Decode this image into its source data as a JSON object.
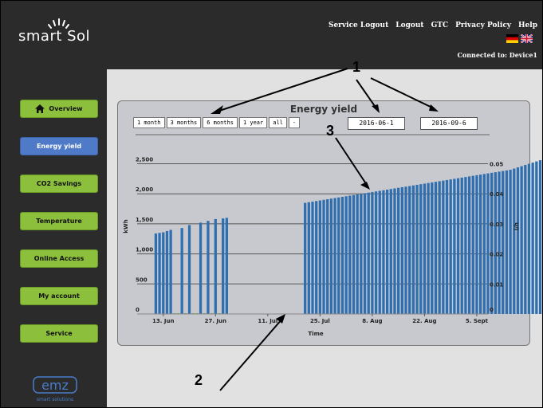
{
  "header": {
    "logo_text": "smart Sol",
    "links": [
      "Service Logout",
      "Logout",
      "GTC",
      "Privacy Policy",
      "Help"
    ],
    "connected_label": "Connected to:",
    "connected_device": "Device1"
  },
  "sidebar": {
    "items": [
      {
        "label": "Overview",
        "active": false
      },
      {
        "label": "Energy yield",
        "active": true
      },
      {
        "label": "CO2 Savings",
        "active": false
      },
      {
        "label": "Temperature",
        "active": false
      },
      {
        "label": "Online Access",
        "active": false
      },
      {
        "label": "My account",
        "active": false
      },
      {
        "label": "Service",
        "active": false
      }
    ],
    "footer_logo": "emz",
    "footer_tagline": "smart solutions"
  },
  "range_buttons": [
    "1 month",
    "3 months",
    "6 months",
    "1 year",
    "all",
    "-"
  ],
  "date_from": "2016-06-1",
  "date_to": "2016-09-6",
  "callouts": [
    "1",
    "2",
    "3"
  ],
  "colors": {
    "bar": "#2f6fb0",
    "nav_green": "#8cbf3c",
    "nav_active": "#4f7ac8"
  },
  "chart_data": {
    "type": "bar",
    "title": "Energy yield",
    "xlabel": "Time",
    "ylabel": "kWh",
    "ylabel_right": "l/h",
    "ylim": [
      0,
      2600
    ],
    "y_ticks": [
      "0",
      "500",
      "1,000",
      "1,500",
      "2,000",
      "2,500"
    ],
    "y2_ticks": [
      "0",
      "0.01",
      "0.02",
      "0.03",
      "0.04",
      "0.05"
    ],
    "x_ticks": [
      "13. Jun",
      "27. Jun",
      "11. Jul",
      "25. Jul",
      "8. Aug",
      "22. Aug",
      "5. Sept"
    ],
    "series": [
      {
        "segments": [
          {
            "start": "2016-06-11",
            "values": [
              1340,
              1350,
              1360,
              1380,
              1400,
              0,
              0,
              1430,
              0,
              1480,
              0,
              0,
              1520,
              0,
              1550,
              0,
              1580,
              0,
              1590,
              1600
            ]
          },
          {
            "start": "2016-07-21",
            "values": [
              1850,
              1860,
              1870,
              1880,
              1890,
              1900,
              1910,
              1920,
              1930,
              1940,
              1950,
              1960,
              1970,
              1980,
              1990,
              2000,
              2010,
              2020,
              2030,
              2040,
              2050,
              2060,
              2070,
              2080,
              2090,
              2100,
              2110,
              2120,
              2130,
              2140,
              2150,
              2160,
              2170,
              2180,
              2190,
              2200,
              2210,
              2220,
              2230,
              2240,
              2250,
              2260,
              2270,
              2280,
              2290,
              2300,
              2310,
              2320,
              2330,
              2340,
              2350,
              2360,
              2370,
              2380,
              2390,
              2400,
              2420,
              2440,
              2460,
              2480,
              2500,
              2520,
              2540,
              2560
            ]
          }
        ]
      }
    ]
  }
}
